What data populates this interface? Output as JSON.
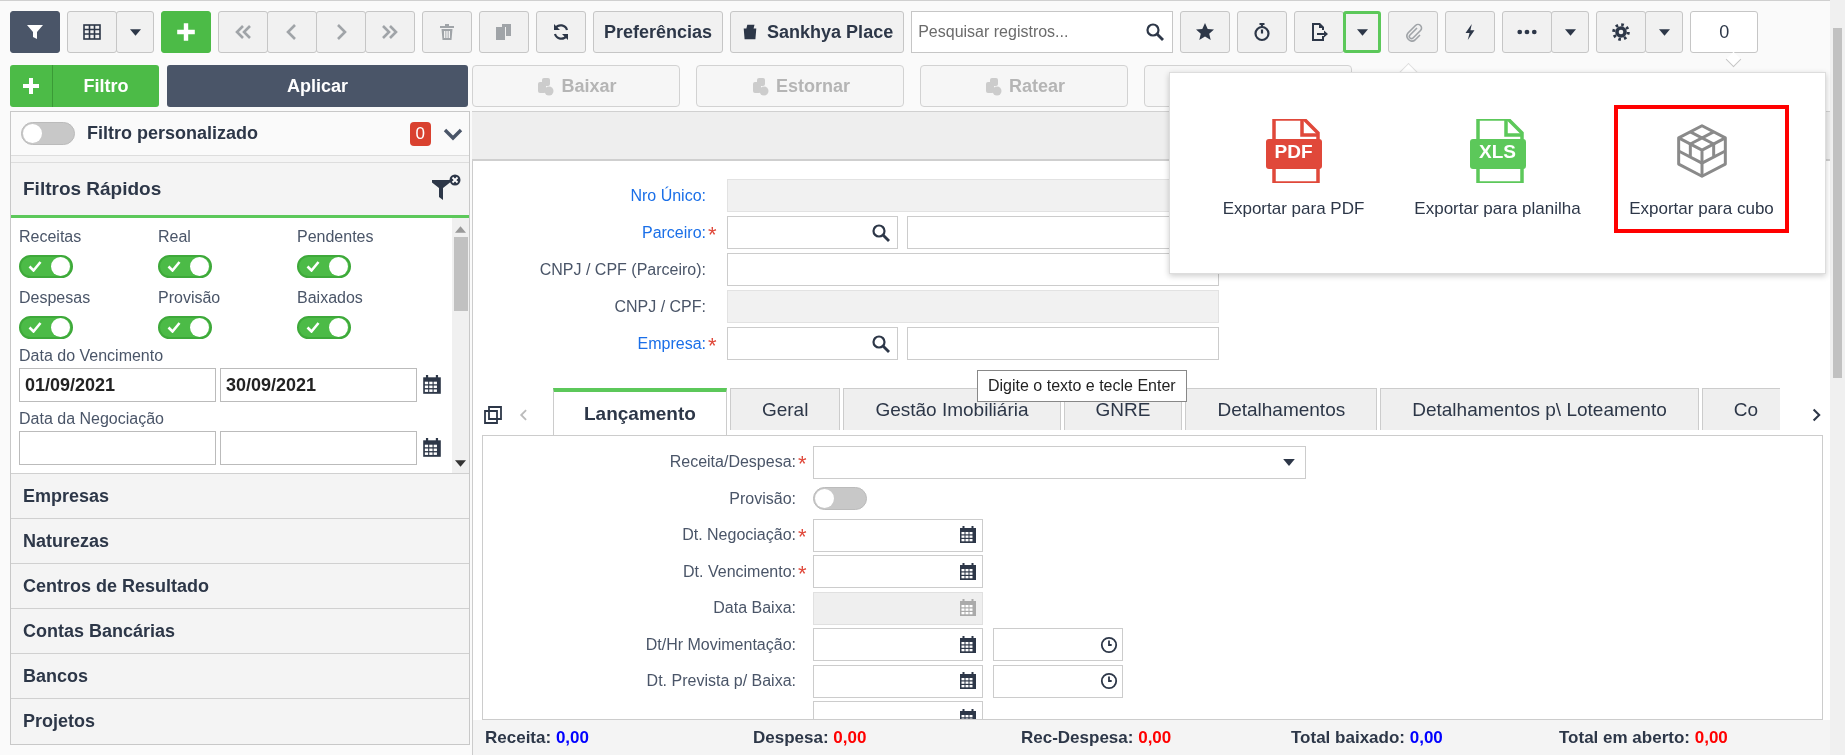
{
  "toolbar": {
    "groups": [
      [
        {
          "kind": "filter",
          "selected": true
        }
      ],
      [
        {
          "kind": "grid",
          "disabled": false
        },
        {
          "kind": "menu",
          "expanded": false
        }
      ],
      [
        {
          "kind": "add",
          "disabled": false
        }
      ],
      [
        {
          "kind": "first",
          "disabled": true
        },
        {
          "kind": "previous",
          "disabled": true
        },
        {
          "kind": "next",
          "disabled": true
        },
        {
          "kind": "last",
          "disabled": true
        }
      ],
      [
        {
          "kind": "delete",
          "disabled": true
        }
      ],
      [
        {
          "kind": "duplicate",
          "disabled": true
        }
      ],
      [
        {
          "kind": "refresh",
          "disabled": false
        }
      ],
      [
        {
          "kind": "text",
          "label": "Preferências"
        }
      ],
      [
        {
          "kind": "place",
          "label": "Sankhya Place"
        }
      ],
      [
        {
          "kind": "search",
          "placeholder": "Pesquisar registros..."
        }
      ],
      [
        {
          "kind": "favorite",
          "disabled": false
        }
      ],
      [
        {
          "kind": "timer",
          "disabled": false
        }
      ],
      [
        {
          "kind": "export",
          "disabled": false
        },
        {
          "kind": "menu",
          "expanded": true
        }
      ],
      [
        {
          "kind": "attach",
          "disabled": true
        }
      ],
      [
        {
          "kind": "action",
          "disabled": false
        }
      ],
      [
        {
          "kind": "more",
          "disabled": false
        },
        {
          "kind": "menu",
          "expanded": false
        }
      ],
      [
        {
          "kind": "settings",
          "disabled": false
        },
        {
          "kind": "menu",
          "expanded": false
        }
      ],
      [
        {
          "kind": "counter",
          "label": "0"
        }
      ]
    ]
  },
  "filter_bar": {
    "add_label": "Filtro",
    "apply_label": "Aplicar"
  },
  "actions": [
    {
      "label": "Baixar",
      "disabled": true
    },
    {
      "label": "Estornar",
      "disabled": true
    },
    {
      "label": "Ratear",
      "disabled": true
    },
    {
      "disabled": true
    }
  ],
  "custom_filter": {
    "label": "Filtro personalizado",
    "on": false,
    "count": "0"
  },
  "quick_filters": {
    "title": "Filtros Rápidos",
    "toggles": [
      {
        "label": "Receitas",
        "on": true
      },
      {
        "label": "Real",
        "on": true
      },
      {
        "label": "Pendentes",
        "on": true
      },
      {
        "label": "Despesas",
        "on": true
      },
      {
        "label": "Provisão",
        "on": true
      },
      {
        "label": "Baixados",
        "on": true
      }
    ],
    "date_ranges": [
      {
        "label": "Data do Vencimento",
        "from": "01/09/2021",
        "to": "30/09/2021"
      },
      {
        "label": "Data da Negociação"
      }
    ]
  },
  "sections": [
    "Empresas",
    "Naturezas",
    "Centros de Resultado",
    "Contas Bancárias",
    "Bancos",
    "Projetos"
  ],
  "header_form": [
    {
      "label": "Nro Único:",
      "kind": "text",
      "link": true,
      "disabled": true
    },
    {
      "label": "Parceiro:",
      "kind": "lookup",
      "link": true,
      "required_mark": "*"
    },
    {
      "label": "CNPJ / CPF (Parceiro):",
      "kind": "text",
      "link": false,
      "disabled": false
    },
    {
      "label": "CNPJ / CPF:",
      "kind": "text",
      "link": false,
      "disabled": true
    },
    {
      "label": "Empresa:",
      "kind": "lookup",
      "link": true,
      "required_mark": "*"
    }
  ],
  "tabs": [
    {
      "label": "Lançamento",
      "selected": true
    },
    {
      "label": "Geral",
      "selected": false
    },
    {
      "label": "Gestão Imobiliária",
      "selected": false
    },
    {
      "label": "GNRE",
      "selected": false
    },
    {
      "label": "Detalhamentos",
      "selected": false
    },
    {
      "label": "Detalhamentos p\\ Loteamento",
      "selected": false
    },
    {
      "label": "Co",
      "selected": false
    }
  ],
  "tooltip": "Digite o texto e tecle Enter",
  "detail_form": [
    {
      "label": "Receita/Despesa:",
      "kind": "select",
      "required_mark": "*"
    },
    {
      "label": "Provisão:",
      "kind": "toggle",
      "on": false
    },
    {
      "label": "Dt. Negociação:",
      "kind": "date",
      "required_mark": "*",
      "disabled": false
    },
    {
      "label": "Dt. Vencimento:",
      "kind": "date",
      "required_mark": "*",
      "disabled": false
    },
    {
      "label": "Data Baixa:",
      "kind": "date",
      "disabled": true
    },
    {
      "label": "Dt/Hr Movimentação:",
      "kind": "datetime",
      "disabled": false
    },
    {
      "label": "Dt. Prevista p/ Baixa:",
      "kind": "datetime",
      "disabled": false
    },
    {
      "kind": "date",
      "disabled": false
    }
  ],
  "export_menu": [
    {
      "label": "Exportar para PDF",
      "kind": "file",
      "badge": "PDF",
      "color": "#e0483a",
      "highlighted": false
    },
    {
      "label": "Exportar para planilha",
      "kind": "file",
      "badge": "XLS",
      "color": "#5cc85a",
      "highlighted": false
    },
    {
      "label": "Exportar para cubo",
      "kind": "cube",
      "highlighted": true
    }
  ],
  "totals": [
    {
      "label": "Receita:",
      "value": "0,00",
      "color": "#0000ff"
    },
    {
      "label": "Despesa:",
      "value": "0,00",
      "color": "#ff0000"
    },
    {
      "label": "Rec-Despesa:",
      "value": "0,00",
      "color": "#ff0000"
    },
    {
      "label": "Total baixado:",
      "value": "0,00",
      "color": "#0000ff"
    },
    {
      "label": "Total em aberto:",
      "value": "0,00",
      "color": "#ff0000"
    }
  ]
}
